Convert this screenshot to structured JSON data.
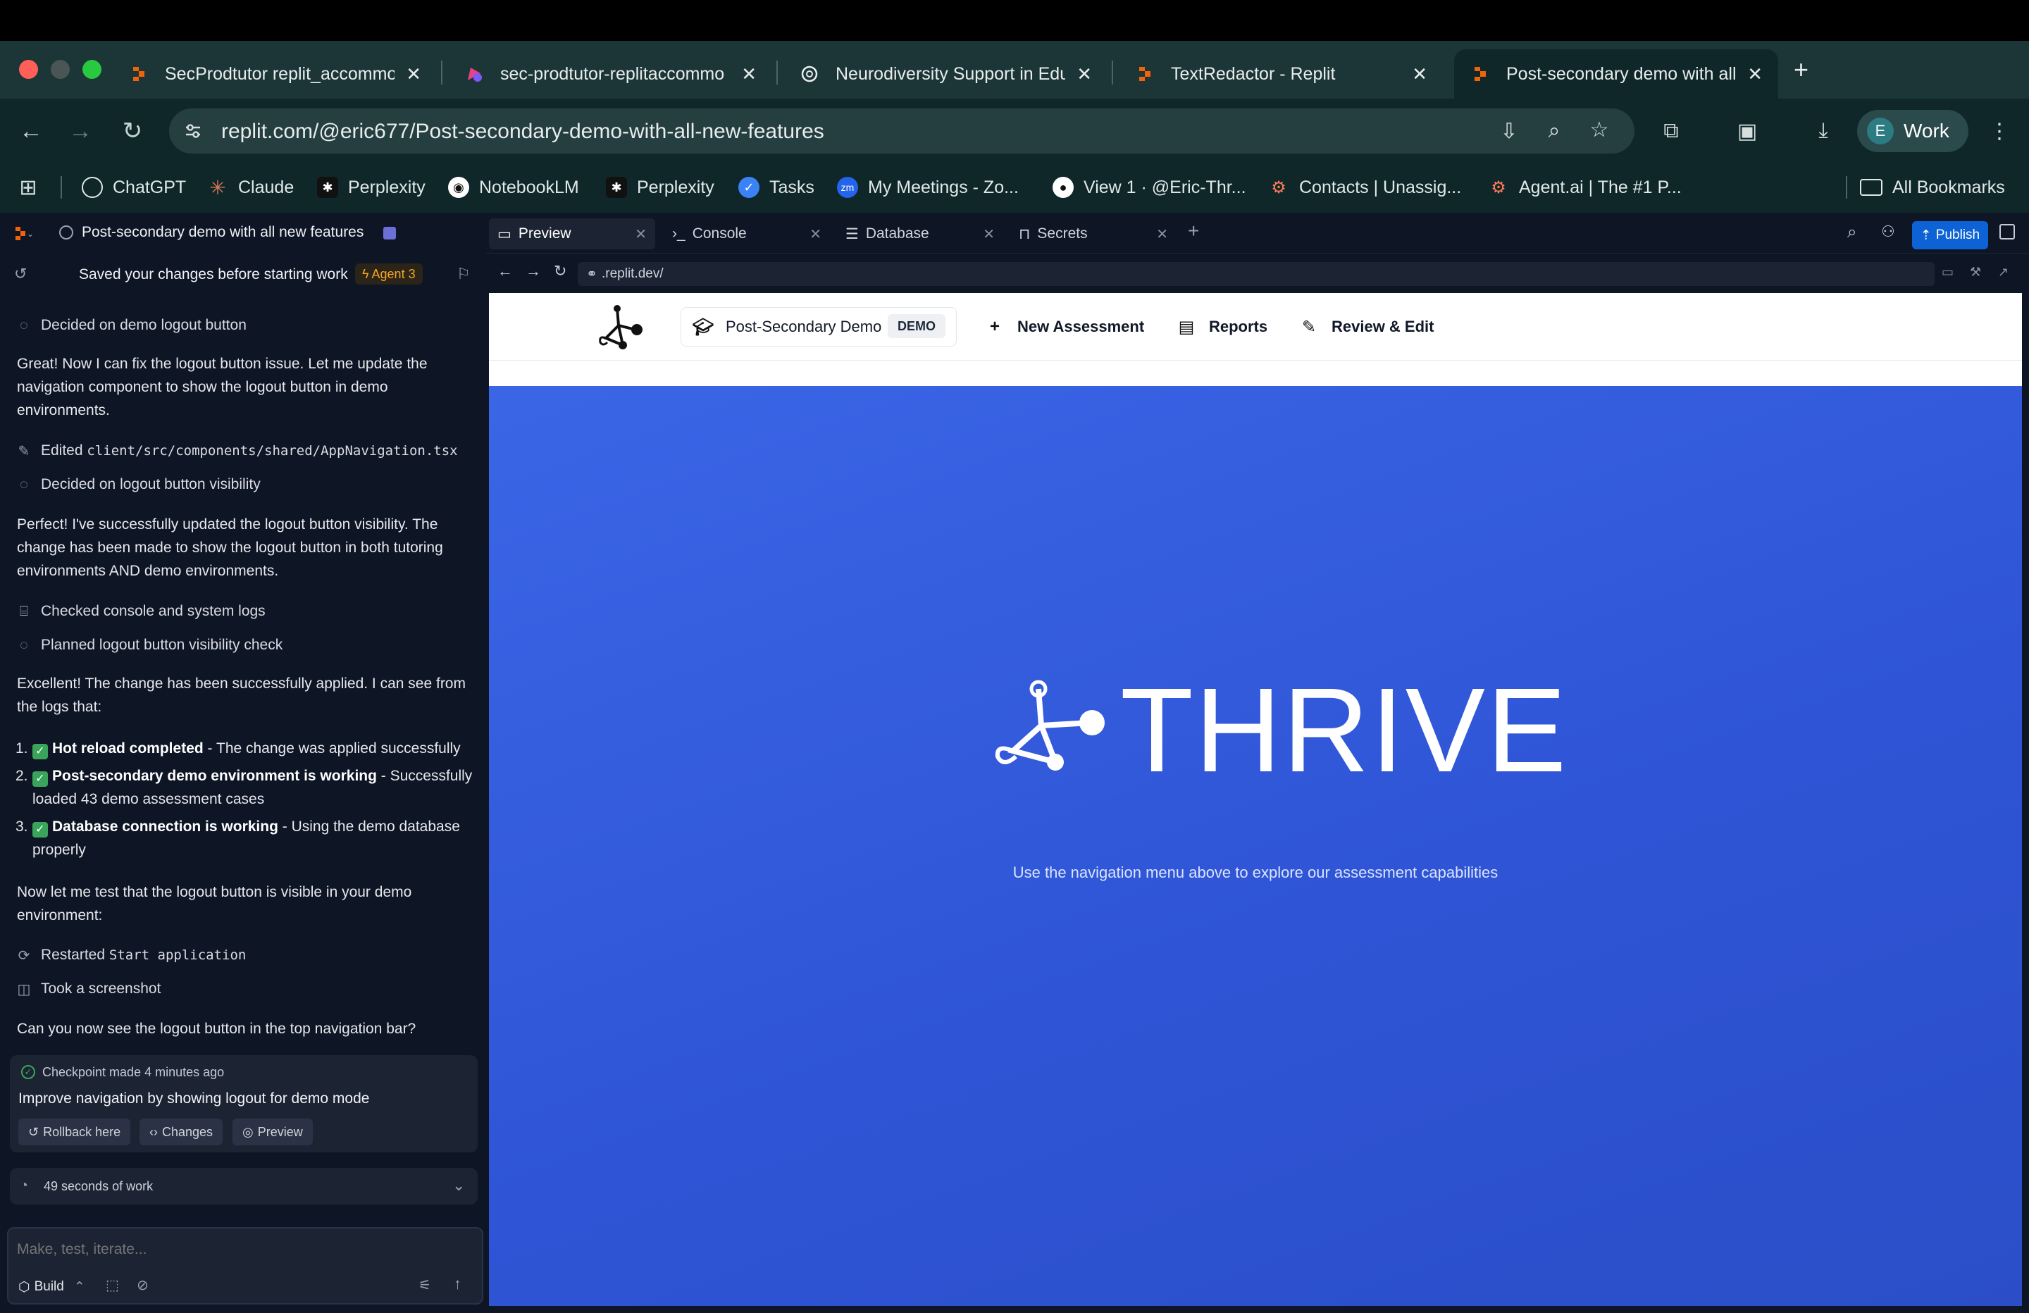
{
  "browser": {
    "tabs": [
      {
        "title": "SecProdtutor replit_accommo",
        "icon": "replit-icon"
      },
      {
        "title": "sec-prodtutor-replitaccommo",
        "icon": "app-icon"
      },
      {
        "title": "Neurodiversity Support in Edu",
        "icon": "openai-icon"
      },
      {
        "title": "TextRedactor - Replit",
        "icon": "replit-icon"
      },
      {
        "title": "Post-secondary demo with all",
        "icon": "replit-icon"
      }
    ],
    "new_tab": "+",
    "close_glyph": "✕",
    "url": "replit.com/@eric677/Post-secondary-demo-with-all-new-features",
    "profile": {
      "initial": "E",
      "name": "Work"
    },
    "bookmarks": [
      {
        "label": "ChatGPT"
      },
      {
        "label": "Claude"
      },
      {
        "label": "Perplexity"
      },
      {
        "label": "NotebookLM"
      },
      {
        "label": "Perplexity"
      },
      {
        "label": "Tasks"
      },
      {
        "label": "My Meetings - Zo..."
      },
      {
        "label": "View 1 · @Eric-Thr..."
      },
      {
        "label": "Contacts | Unassig..."
      },
      {
        "label": "Agent.ai | The #1 P..."
      }
    ],
    "all_bookmarks": "All Bookmarks"
  },
  "replit": {
    "project_title": "Post-secondary demo with all new features",
    "saved_message": "Saved your changes before starting work",
    "agent_badge": "Agent 3",
    "chat": {
      "decided_1": "Decided on demo logout button",
      "para_1": "Great! Now I can fix the logout button issue. Let me update the navigation component to show the logout button in demo environments.",
      "edited_prefix": "Edited",
      "edited_file": "client/src/components/shared/AppNavigation.tsx",
      "decided_2": "Decided on logout button visibility",
      "para_2": "Perfect! I've successfully updated the logout button visibility. The change has been made to show the logout button in both tutoring environments AND demo environments.",
      "checked_logs": "Checked console and system logs",
      "planned": "Planned logout button visibility check",
      "para_3": "Excellent! The change has been successfully applied. I can see from the logs that:",
      "list": [
        {
          "num": "1.",
          "bold": "Hot reload completed",
          "rest": " - The change was applied successfully"
        },
        {
          "num": "2.",
          "bold": "Post-secondary demo environment is working",
          "rest": " - Successfully loaded 43 demo assessment cases"
        },
        {
          "num": "3.",
          "bold": "Database connection is working",
          "rest": " - Using the demo database properly"
        }
      ],
      "para_4": "Now let me test that the logout button is visible in your demo environment:",
      "restarted_prefix": "Restarted",
      "restarted_cmd": "Start application",
      "screenshot": "Took a screenshot",
      "question": "Can you now see the logout button in the top navigation bar?"
    },
    "checkpoint": {
      "made": "Checkpoint made 4 minutes ago",
      "message": "Improve navigation by showing logout for demo mode",
      "rollback": "Rollback here",
      "changes": "Changes",
      "preview": "Preview"
    },
    "work_time": "49 seconds of work",
    "composer": {
      "placeholder": "Make, test, iterate...",
      "mode": "Build"
    },
    "tabs": [
      {
        "label": "Preview",
        "icon": "monitor-icon"
      },
      {
        "label": "Console",
        "icon": "terminal-icon"
      },
      {
        "label": "Database",
        "icon": "database-icon"
      },
      {
        "label": "Secrets",
        "icon": "lock-icon"
      }
    ],
    "publish": "Publish",
    "preview_url": ".replit.dev/"
  },
  "app": {
    "brand": "Post-Secondary Demo",
    "demo_badge": "DEMO",
    "nav": [
      "New Assessment",
      "Reports",
      "Review & Edit"
    ],
    "hero_title": "THRIVE",
    "hero_subtitle": "Use the navigation menu above to explore our assessment capabilities"
  },
  "colors": {
    "hero_blue": "#3a66e6",
    "publish_blue": "#0d63d6",
    "chrome_dark": "#0f2729",
    "workspace_bg": "#0e1525"
  }
}
